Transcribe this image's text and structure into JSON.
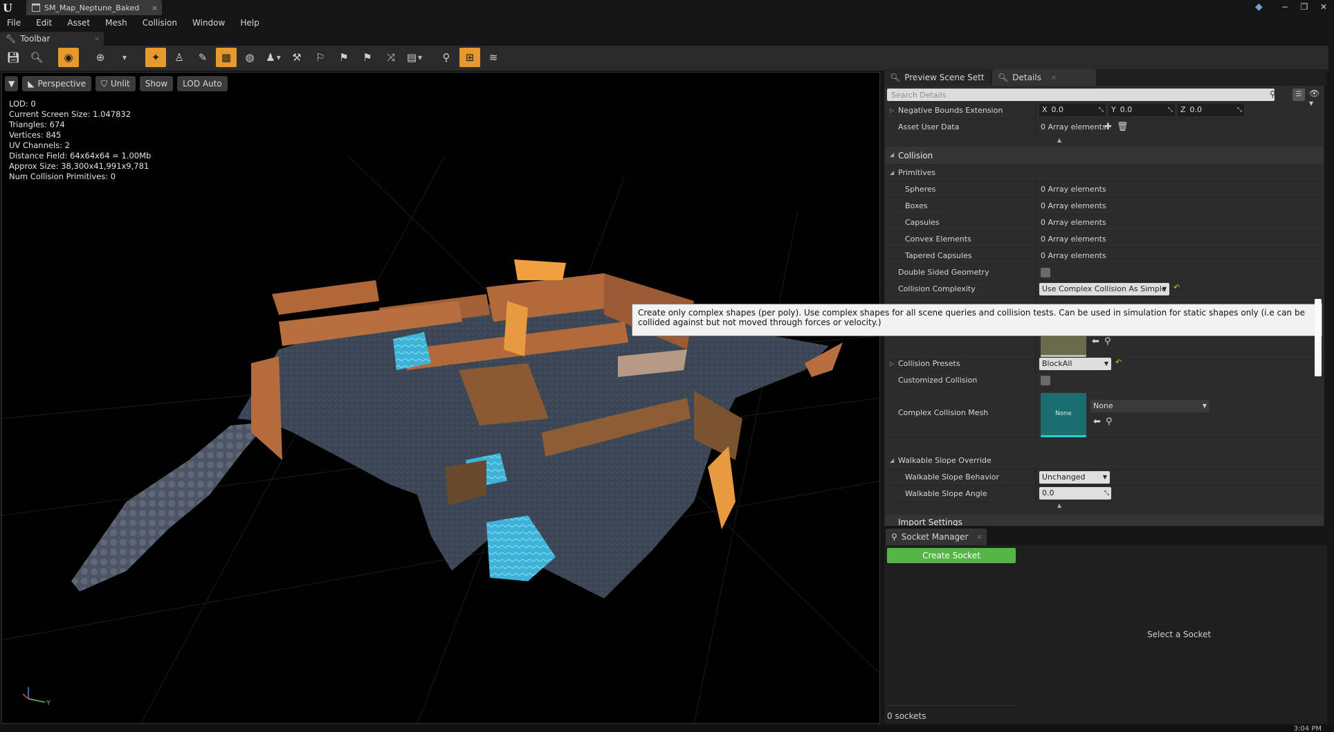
{
  "titlebar": {
    "asset_tab": "SM_Map_Neptune_Baked",
    "close_glyph": "×",
    "window_controls": [
      "−",
      "❐",
      "✕"
    ]
  },
  "menubar": [
    "File",
    "Edit",
    "Asset",
    "Mesh",
    "Collision",
    "Window",
    "Help"
  ],
  "toolbar_tab": {
    "label": "Toolbar"
  },
  "viewport": {
    "buttons": {
      "perspective": "Perspective",
      "unlit": "Unlit",
      "show": "Show",
      "lod": "LOD Auto"
    },
    "stats": [
      "LOD:  0",
      "Current Screen Size:  1.047832",
      "Triangles:  674",
      "Vertices:  845",
      "UV Channels:  2",
      "Distance Field:  64x64x64 = 1.00Mb",
      "Approx Size: 38,300x41,991x9,781",
      "Num Collision Primitives:  0"
    ],
    "axis_y": "Y"
  },
  "panel_tabs": {
    "preview": "Preview Scene Sett",
    "details": "Details"
  },
  "details": {
    "search_placeholder": "Search Details",
    "negative_bounds": {
      "label": "Negative Bounds Extension",
      "x": "0.0",
      "y": "0.0",
      "z": "0.0",
      "x_axis": "X",
      "y_axis": "Y",
      "z_axis": "Z"
    },
    "asset_user_data": {
      "label": "Asset User Data",
      "value": "0 Array elements"
    },
    "collision_category": "Collision",
    "primitives": "Primitives",
    "spheres": {
      "label": "Spheres",
      "value": "0 Array elements"
    },
    "boxes": {
      "label": "Boxes",
      "value": "0 Array elements"
    },
    "capsules": {
      "label": "Capsules",
      "value": "0 Array elements"
    },
    "convex": {
      "label": "Convex Elements",
      "value": "0 Array elements"
    },
    "tapered": {
      "label": "Tapered Capsules",
      "value": "0 Array elements"
    },
    "double_sided": {
      "label": "Double Sided Geometry"
    },
    "complexity": {
      "label": "Collision Complexity",
      "value": "Use Complex Collision As Simple"
    },
    "presets": {
      "label": "Collision Presets",
      "value": "BlockAll"
    },
    "customized": {
      "label": "Customized Collision"
    },
    "complex_mesh": {
      "label": "Complex Collision Mesh",
      "thumb": "None",
      "value": "None"
    },
    "walkable": {
      "label": "Walkable Slope Override"
    },
    "walkable_behavior": {
      "label": "Walkable Slope Behavior",
      "value": "Unchanged"
    },
    "walkable_angle": {
      "label": "Walkable Slope Angle",
      "value": "0.0"
    },
    "next_category_partial": "Import Settings"
  },
  "tooltip": "Create only complex shapes (per poly). Use complex shapes for all scene queries and collision tests. Can be used in simulation for static shapes only (i.e can be collided against but not moved through forces or velocity.)",
  "socket_manager": {
    "tab": "Socket Manager",
    "create": "Create Socket",
    "empty": "Select a Socket",
    "count": "0 sockets"
  },
  "clock": "3:04 PM",
  "colors": {
    "accent": "#e69a2e",
    "create_socket": "#55b547",
    "reset_arrow": "#d7c200",
    "mesh_thumb": "#1a6e6e",
    "material_thumb": "#6b6a4a"
  },
  "icons": [
    "save-icon",
    "find-in-browser-icon",
    "realtime-icon",
    "transform-icon",
    "collision-icon",
    "home-icon",
    "search-icon",
    "eye-icon",
    "plus-icon",
    "trash-icon",
    "browse-arrow-icon",
    "magnify-icon",
    "wrench-icon"
  ]
}
